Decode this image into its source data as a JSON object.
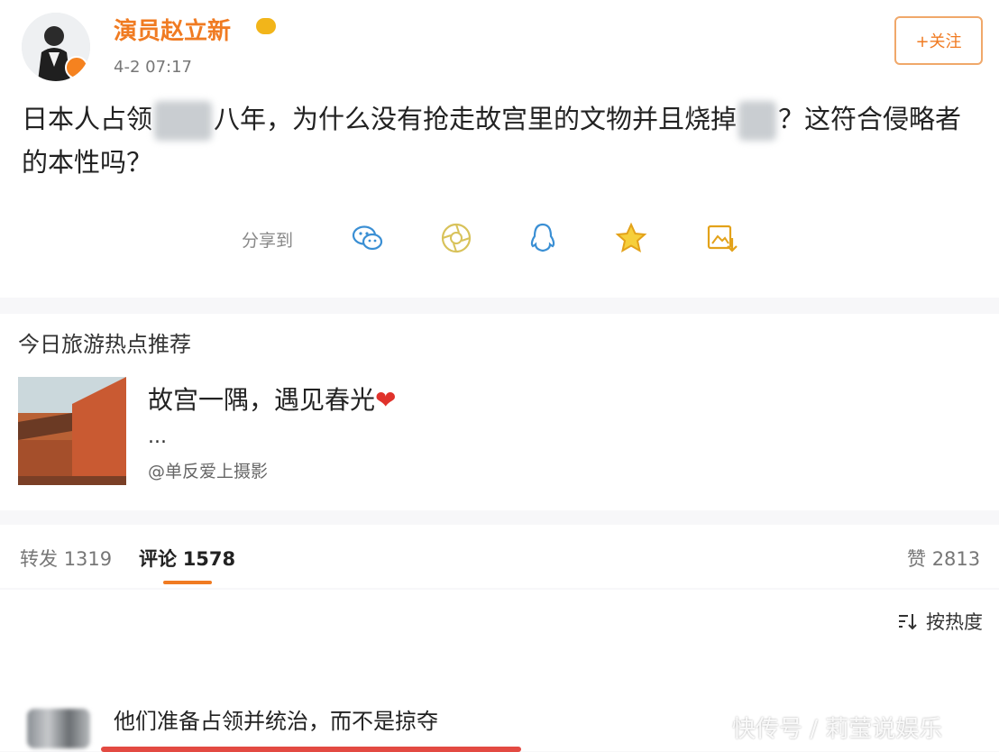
{
  "post": {
    "username": "演员赵立新",
    "time": "4-2 07:17",
    "follow_label": "+关注",
    "text_part1": "日本人占领",
    "text_part2": "八年，为什么没有抢走故宫里的文物并且烧掉",
    "text_part3": "？这符合侵略者的本性吗？",
    "share_label": "分享到",
    "share_icons": [
      "wechat-icon",
      "moments-icon",
      "qq-icon",
      "favorite-star-icon",
      "save-image-icon"
    ]
  },
  "hot": {
    "title": "今日旅游热点推荐",
    "headline": "故宫一隅，遇见春光",
    "heart": "❤",
    "ellipsis": "...",
    "source": "@单反爱上摄影"
  },
  "tabs": {
    "repost_label": "转发",
    "repost_count": "1319",
    "comment_label": "评论",
    "comment_count": "1578",
    "like_label": "赞",
    "like_count": "2813"
  },
  "sort": {
    "label": "按热度"
  },
  "comment": {
    "text": "他们准备占领并统治，而不是掠夺"
  },
  "watermark": "快传号 / 莉莹说娱乐",
  "colors": {
    "accent": "#f07b22",
    "heart": "#e0322b"
  }
}
